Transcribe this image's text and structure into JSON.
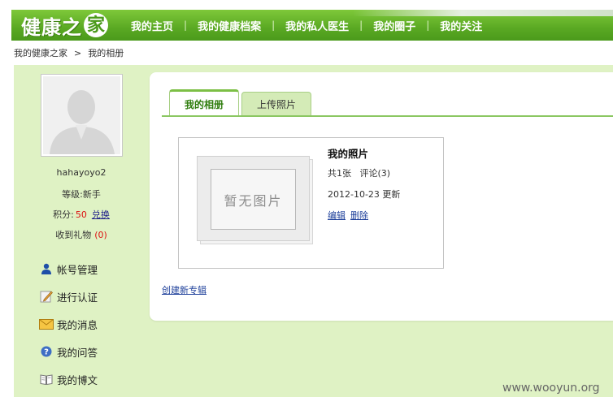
{
  "header": {
    "logo": {
      "text_main": "健康之",
      "text_ring": "家"
    },
    "nav": [
      {
        "label": "我的主页"
      },
      {
        "label": "我的健康档案"
      },
      {
        "label": "我的私人医生"
      },
      {
        "label": "我的圈子"
      },
      {
        "label": "我的关注"
      }
    ],
    "separator": "|"
  },
  "breadcrumb": {
    "home": "我的健康之家",
    "sep": ">",
    "current": "我的相册"
  },
  "profile": {
    "username": "hahayoyo2",
    "level_text": "等级:新手",
    "points_label": "积分:",
    "points_value": "50",
    "exchange_link": "兑换",
    "gifts_label": "收到礼物",
    "gifts_value": "(0)"
  },
  "sidebar": {
    "items": [
      {
        "label": "帐号管理",
        "icon": "user-icon"
      },
      {
        "label": "进行认证",
        "icon": "pencil-note-icon"
      },
      {
        "label": "我的消息",
        "icon": "envelope-icon"
      },
      {
        "label": "我的问答",
        "icon": "question-icon"
      },
      {
        "label": "我的博文",
        "icon": "book-icon"
      }
    ]
  },
  "tabs": [
    {
      "label": "我的相册",
      "active": true
    },
    {
      "label": "上传照片",
      "active": false
    }
  ],
  "album": {
    "placeholder_text": "暂无图片",
    "title": "我的照片",
    "count_text": "共1张",
    "comments_text": "评论(3)",
    "updated_text": "2012-10-23 更新",
    "edit_link": "编辑",
    "delete_link": "删除"
  },
  "create_album_link": "创建新专辑",
  "watermark": "www.wooyun.org",
  "colors": {
    "brand_green": "#5aa923",
    "page_green": "#dff2c4",
    "link_blue": "#1d3f9a",
    "highlight_red": "#dd1111"
  }
}
